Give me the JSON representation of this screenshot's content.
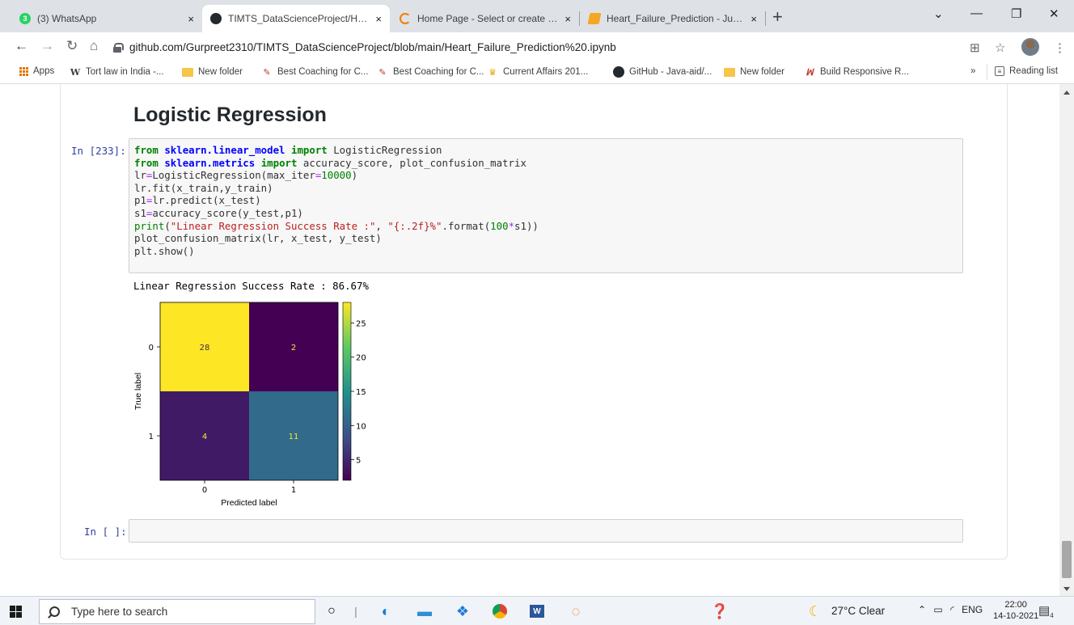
{
  "browser": {
    "tabs": [
      {
        "title": "(3) WhatsApp",
        "close": "×",
        "active": false
      },
      {
        "title": "TIMTS_DataScienceProject/Heart_",
        "close": "×",
        "active": true
      },
      {
        "title": "Home Page - Select or create a n",
        "close": "×",
        "active": false
      },
      {
        "title": "Heart_Failure_Prediction - Jupyte",
        "close": "×",
        "active": false
      }
    ],
    "new_tab": "+",
    "url": "github.com/Gurpreet2310/TIMTS_DataScienceProject/blob/main/Heart_Failure_Prediction%20.ipynb",
    "bookmarks": [
      {
        "label": "Apps",
        "icon": "apps-grid-icon"
      },
      {
        "label": "Tort law in India -...",
        "icon": "w-logo-icon"
      },
      {
        "label": "New folder",
        "icon": "folder-icon"
      },
      {
        "label": "Best Coaching for C...",
        "icon": "pen-icon"
      },
      {
        "label": "Best Coaching for C...",
        "icon": "pen-icon"
      },
      {
        "label": "Current Affairs 201...",
        "icon": "trophy-icon"
      },
      {
        "label": "GitHub - Java-aid/...",
        "icon": "github-icon"
      },
      {
        "label": "New folder",
        "icon": "folder-icon"
      },
      {
        "label": "Build Responsive R...",
        "icon": "w3-icon"
      }
    ],
    "bookmarks_overflow": "»",
    "reading_list": "Reading list"
  },
  "notebook": {
    "heading": "Logistic Regression",
    "cell_prompt": "In [233]:",
    "code_lines": [
      "from sklearn.linear_model import LogisticRegression",
      "from sklearn.metrics import accuracy_score, plot_confusion_matrix",
      "lr=LogisticRegression(max_iter=10000)",
      "lr.fit(x_train,y_train)",
      "p1=lr.predict(x_test)",
      "s1=accuracy_score(y_test,p1)",
      "print(\"Linear Regression Success Rate :\", \"{:.2f}%\".format(100*s1))",
      "plot_confusion_matrix(lr, x_test, y_test)",
      "plt.show()"
    ],
    "output_text": "Linear Regression Success Rate : 86.67%",
    "empty_prompt": "In [ ]:"
  },
  "chart_data": {
    "type": "heatmap",
    "title": "",
    "xlabel": "Predicted label",
    "ylabel": "True label",
    "x_ticks": [
      "0",
      "1"
    ],
    "y_ticks": [
      "0",
      "1"
    ],
    "values": [
      [
        28,
        2
      ],
      [
        4,
        11
      ]
    ],
    "colormap": "viridis",
    "colorbar_ticks": [
      5,
      10,
      15,
      20,
      25
    ],
    "colorbar_range": [
      2,
      28
    ]
  },
  "taskbar": {
    "search_placeholder": "Type here to search",
    "weather": "27°C Clear",
    "language": "ENG",
    "time": "22:00",
    "date": "14-10-2021",
    "notifications": "4"
  }
}
